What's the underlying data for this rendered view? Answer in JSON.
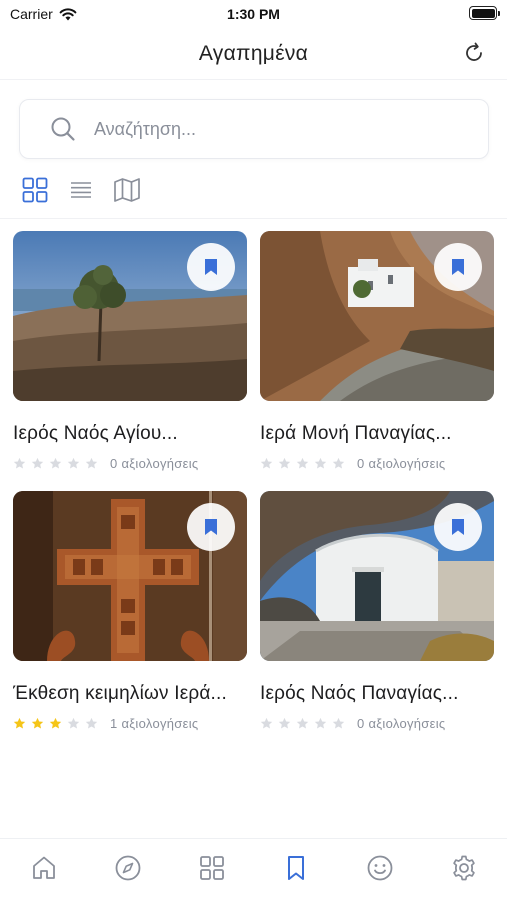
{
  "status_bar": {
    "carrier": "Carrier",
    "time": "1:30 PM"
  },
  "header": {
    "title": "Αγαπημένα"
  },
  "search": {
    "placeholder": "Αναζήτηση..."
  },
  "colors": {
    "accent": "#3a6fd8",
    "icon_gray": "#8a8f9a",
    "star_filled": "#f5c518",
    "star_empty": "#d9dbe0"
  },
  "cards": [
    {
      "title": "Ιερός Ναός Αγίου...",
      "rating": 0,
      "rating_text": "0 αξιολογήσεις",
      "bookmarked": true
    },
    {
      "title": "Ιερά Μονή Παναγίας...",
      "rating": 0,
      "rating_text": "0 αξιολογήσεις",
      "bookmarked": true
    },
    {
      "title": "Έκθεση κειμηλίων Ιερά...",
      "rating": 3,
      "rating_text": "1 αξιολογήσεις",
      "bookmarked": true
    },
    {
      "title": "Ιερός Ναός Παναγίας...",
      "rating": 0,
      "rating_text": "0 αξιολογήσεις",
      "bookmarked": true
    }
  ],
  "tabs": [
    {
      "icon": "home-icon",
      "active": false
    },
    {
      "icon": "compass-icon",
      "active": false
    },
    {
      "icon": "grid-icon",
      "active": false
    },
    {
      "icon": "bookmark-icon",
      "active": true
    },
    {
      "icon": "smiley-icon",
      "active": false
    },
    {
      "icon": "gear-icon",
      "active": false
    }
  ]
}
